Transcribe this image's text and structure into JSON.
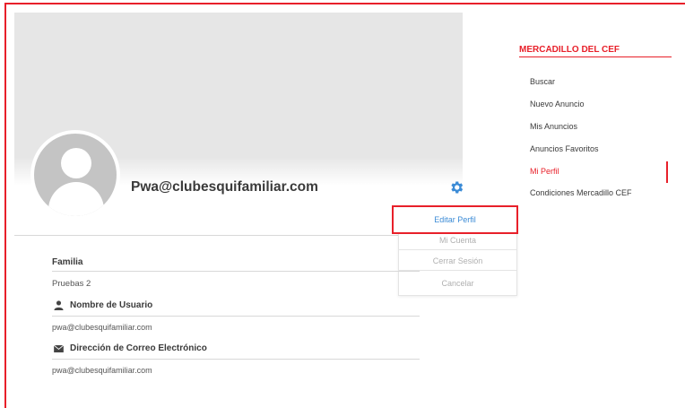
{
  "profile": {
    "username": "Pwa@clubesquifamiliar.com",
    "group_label": "Familia",
    "group_value": "Pruebas 2",
    "user_name_label": "Nombre de Usuario",
    "user_name_value": "pwa@clubesquifamiliar.com",
    "email_label": "Dirección de Correo Electrónico",
    "email_value": "pwa@clubesquifamiliar.com"
  },
  "menu": {
    "edit_profile": "Editar Perfil",
    "my_account": "Mi Cuenta",
    "logout": "Cerrar Sesión",
    "cancel": "Cancelar"
  },
  "sidebar": {
    "title": "MERCADILLO DEL CEF",
    "items": [
      {
        "label": "Buscar"
      },
      {
        "label": "Nuevo Anuncio"
      },
      {
        "label": "Mis Anuncios"
      },
      {
        "label": "Anuncios Favoritos"
      },
      {
        "label": "Mi Perfil",
        "active": true
      },
      {
        "label": "Condiciones Mercadillo CEF"
      }
    ]
  },
  "colors": {
    "accent": "#e8202a",
    "link": "#3b8bd6",
    "gear": "#3b8bd6"
  },
  "icons": {
    "settings": "gear-icon",
    "user": "user-icon",
    "mail": "envelope-icon",
    "avatar": "avatar-placeholder"
  }
}
